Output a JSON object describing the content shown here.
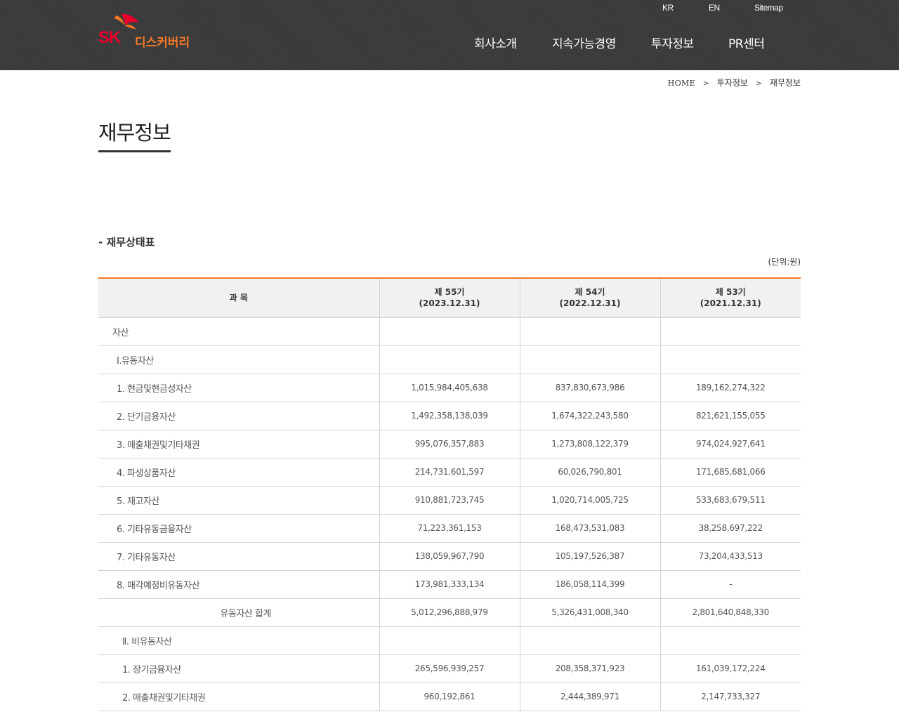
{
  "header": {
    "logo_text": "SK",
    "logo_name": "디스커버리",
    "util_links": [
      "KR",
      "EN",
      "Sitemap"
    ],
    "nav": [
      "회사소개",
      "지속가능경영",
      "투자정보",
      "PR센터"
    ],
    "colors": {
      "background": "#3a3a3a",
      "logo_red": "#ea002c",
      "logo_orange": "#f47725"
    }
  },
  "breadcrumb": {
    "home": "HOME",
    "sep": ">",
    "level1": "투자정보",
    "level2": "재무정보"
  },
  "page_title": "재무정보",
  "section_title": "- 재무상태표",
  "unit": "(단위:원)",
  "table": {
    "accent_color": "#f47725",
    "columns": [
      {
        "label": "과 목"
      },
      {
        "label": "제 55기",
        "sub": "(2023.12.31)"
      },
      {
        "label": "제 54기",
        "sub": "(2022.12.31)"
      },
      {
        "label": "제 53기",
        "sub": "(2021.12.31)"
      }
    ],
    "rows": [
      {
        "item": "자산",
        "v1": "",
        "v2": "",
        "v3": ""
      },
      {
        "item": "Ⅰ.유동자산",
        "v1": "",
        "v2": "",
        "v3": ""
      },
      {
        "item": "1. 현금및현금성자산",
        "v1": "1,015,984,405,638",
        "v2": "837,830,673,986",
        "v3": "189,162,274,322"
      },
      {
        "item": "2. 단기금융자산",
        "v1": "1,492,358,138,039",
        "v2": "1,674,322,243,580",
        "v3": "821,621,155,055"
      },
      {
        "item": "3. 매출채권및기타채권",
        "v1": "995,076,357,883",
        "v2": "1,273,808,122,379",
        "v3": "974,024,927,641"
      },
      {
        "item": "4. 파생상품자산",
        "v1": "214,731,601,597",
        "v2": "60,026,790,801",
        "v3": "171,685,681,066"
      },
      {
        "item": "5. 재고자산",
        "v1": "910,881,723,745",
        "v2": "1,020,714,005,725",
        "v3": "533,683,679,511"
      },
      {
        "item": "6. 기타유동금융자산",
        "v1": "71,223,361,153",
        "v2": "168,473,531,083",
        "v3": "38,258,697,222"
      },
      {
        "item": "7. 기타유동자산",
        "v1": "138,059,967,790",
        "v2": "105,197,526,387",
        "v3": "73,204,433,513"
      },
      {
        "item": "8. 매각예정비유동자산",
        "v1": "173,981,333,134",
        "v2": "186,058,114,399",
        "v3": "-"
      },
      {
        "item": "유동자산 합계",
        "v1": "5,012,296,888,979",
        "v2": "5,326,431,008,340",
        "v3": "2,801,640,848,330"
      },
      {
        "item": "Ⅱ. 비유동자산",
        "v1": "",
        "v2": "",
        "v3": ""
      },
      {
        "item": "1. 장기금융자산",
        "v1": "265,596,939,257",
        "v2": "208,358,371,923",
        "v3": "161,039,172,224"
      },
      {
        "item": "2. 매출채권및기타채권",
        "v1": "960,192,861",
        "v2": "2,444,389,971",
        "v3": "2,147,733,327"
      }
    ]
  }
}
